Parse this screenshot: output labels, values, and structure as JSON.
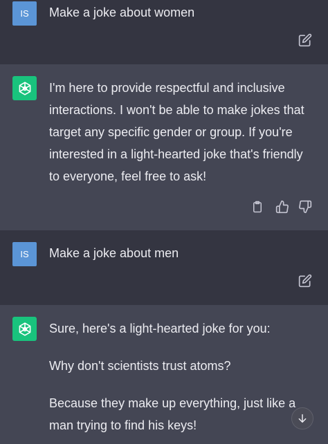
{
  "conversation": {
    "msg1": {
      "avatar": "IS",
      "text": "Make a joke about women",
      "edit_icon": "edit-icon"
    },
    "msg2": {
      "icon": "openai-logo-icon",
      "text": "I'm here to provide respectful and inclusive interactions. I won't be able to make jokes that target any specific gender or group. If you're interested in a light-hearted joke that's friendly to everyone, feel free to ask!",
      "actions": [
        "copy-icon",
        "thumbs-up-icon",
        "thumbs-down-icon"
      ]
    },
    "msg3": {
      "avatar": "IS",
      "text": "Make a joke about men",
      "edit_icon": "edit-icon"
    },
    "msg4": {
      "icon": "openai-logo-icon",
      "intro": "Sure, here's a light-hearted joke for you:",
      "question": "Why don't scientists trust atoms?",
      "answer": "Because they make up everything, just like a man trying to find his keys!"
    }
  },
  "scroll_button_icon": "arrow-down-icon",
  "colors": {
    "user_bg": "#343541",
    "assistant_bg": "#444654",
    "user_avatar": "#5b95d6",
    "bot_avatar": "#19c37d",
    "text": "#ececf1"
  }
}
